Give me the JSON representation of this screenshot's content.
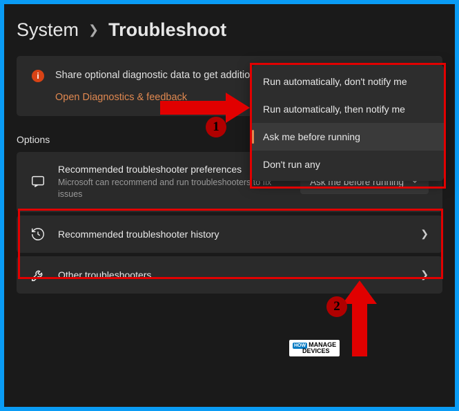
{
  "breadcrumb": {
    "parent": "System",
    "current": "Troubleshoot"
  },
  "infoCard": {
    "text": "Share optional diagnostic data to get additional troubleshooting recommendations.",
    "link": "Open Diagnostics & feedback"
  },
  "dropdown": {
    "items": [
      "Run automatically, don't notify me",
      "Run automatically, then notify me",
      "Ask me before running",
      "Don't run any"
    ],
    "selectedIndex": 2
  },
  "sectionLabel": "Options",
  "preferences": {
    "title": "Recommended troubleshooter preferences",
    "sub": "Microsoft can recommend and run troubleshooters to fix issues",
    "selected": "Ask me before running"
  },
  "historyRow": {
    "title": "Recommended troubleshooter history"
  },
  "otherRow": {
    "title": "Other troubleshooters"
  },
  "watermark": {
    "pre": "HOW",
    "line1": "MANAGE",
    "line2": "DEVICES"
  }
}
